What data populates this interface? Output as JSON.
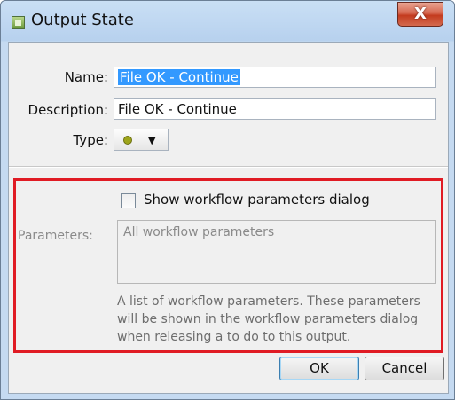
{
  "window": {
    "title": "Output State",
    "close_label": "X"
  },
  "form": {
    "name_label": "Name:",
    "name_value": "File OK - Continue",
    "description_label": "Description:",
    "description_value": "File OK - Continue",
    "type_label": "Type:",
    "type_arrow": "▼"
  },
  "params": {
    "checkbox_label": "Show workflow parameters dialog",
    "label": "Parameters:",
    "box_text": "All workflow parameters",
    "help_text": "A list of workflow parameters. These parameters will be shown in the workflow parameters dialog when releasing a to do to this output."
  },
  "buttons": {
    "ok": "OK",
    "cancel": "Cancel"
  },
  "colors": {
    "highlight_border": "#e01b24",
    "type_dot": "#9ea51a",
    "selection": "#3399ff"
  }
}
